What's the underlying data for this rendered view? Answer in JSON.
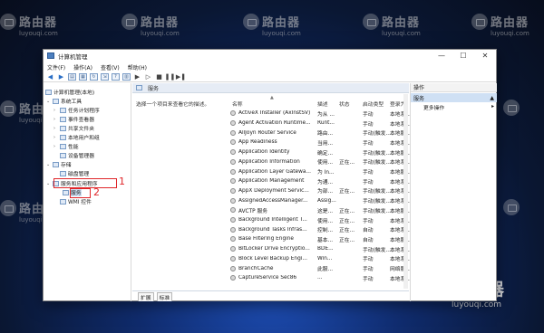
{
  "watermark": {
    "name": "路由器",
    "site": "luyouqi.com"
  },
  "window": {
    "title": "计算机管理",
    "controls": {
      "minimize": "—",
      "maximize": "☐",
      "close": "✕"
    }
  },
  "menu": [
    "文件(F)",
    "操作(A)",
    "查看(V)",
    "帮助(H)"
  ],
  "tree": {
    "root": "计算机管理(本地)",
    "system_tools": "系统工具",
    "task_scheduler": "任务计划程序",
    "event_viewer": "事件查看器",
    "shared_folders": "共享文件夹",
    "local_users": "本地用户和组",
    "performance": "性能",
    "device_manager": "设备管理器",
    "storage": "存储",
    "disk_management": "磁盘管理",
    "services_apps": "服务和应用程序",
    "services": "服务",
    "wmi": "WMI 控件"
  },
  "annotations": {
    "n1": "1",
    "n2": "2"
  },
  "center": {
    "header": "服务",
    "description": "选择一个项目来查看它的描述。",
    "columns": {
      "name": "名称",
      "desc": "描述",
      "state": "状态",
      "startup": "启动类型",
      "login": "登录为"
    },
    "rows": [
      {
        "name": "ActiveX Installer (AxInstSV)",
        "desc": "为从 ...",
        "state": "",
        "startup": "手动",
        "login": "本地系..."
      },
      {
        "name": "Agent Activation Runtime...",
        "desc": "Runt...",
        "state": "",
        "startup": "手动",
        "login": "本地系..."
      },
      {
        "name": "AllJoyn Router Service",
        "desc": "路由...",
        "state": "",
        "startup": "手动(触发...",
        "login": "本地服..."
      },
      {
        "name": "App Readiness",
        "desc": "当用...",
        "state": "",
        "startup": "手动",
        "login": "本地系..."
      },
      {
        "name": "Application Identity",
        "desc": "确定...",
        "state": "",
        "startup": "手动(触发...",
        "login": "本地服..."
      },
      {
        "name": "Application Information",
        "desc": "使用...",
        "state": "正在...",
        "startup": "手动(触发...",
        "login": "本地系..."
      },
      {
        "name": "Application Layer Gatewa...",
        "desc": "为 In...",
        "state": "",
        "startup": "手动",
        "login": "本地服..."
      },
      {
        "name": "Application Management",
        "desc": "为通...",
        "state": "",
        "startup": "手动",
        "login": "本地系..."
      },
      {
        "name": "AppX Deployment Servic...",
        "desc": "为部...",
        "state": "正在...",
        "startup": "手动(触发...",
        "login": "本地系..."
      },
      {
        "name": "AssignedAccessManager...",
        "desc": "Assig...",
        "state": "",
        "startup": "手动(触发...",
        "login": "本地系..."
      },
      {
        "name": "AVCTP 服务",
        "desc": "这是...",
        "state": "正在...",
        "startup": "手动(触发...",
        "login": "本地服..."
      },
      {
        "name": "Background Intelligent T...",
        "desc": "使用...",
        "state": "正在...",
        "startup": "手动",
        "login": "本地系..."
      },
      {
        "name": "Background Tasks Infras...",
        "desc": "控制...",
        "state": "正在...",
        "startup": "自动",
        "login": "本地系..."
      },
      {
        "name": "Base Filtering Engine",
        "desc": "基本...",
        "state": "正在...",
        "startup": "自动",
        "login": "本地服..."
      },
      {
        "name": "BitLocker Drive Encryptio...",
        "desc": "BDE...",
        "state": "",
        "startup": "手动(触发...",
        "login": "本地系..."
      },
      {
        "name": "Block Level Backup Engi...",
        "desc": "Win...",
        "state": "",
        "startup": "手动",
        "login": "本地系..."
      },
      {
        "name": "BranchCache",
        "desc": "此服...",
        "state": "",
        "startup": "手动",
        "login": "网络服..."
      },
      {
        "name": "CaptureService Sec86",
        "desc": "...",
        "state": "",
        "startup": "手动",
        "login": "本地系..."
      }
    ],
    "tabs": [
      "扩展",
      "标准"
    ]
  },
  "actions": {
    "title": "操作",
    "section": "服务",
    "more": "更多操作"
  }
}
